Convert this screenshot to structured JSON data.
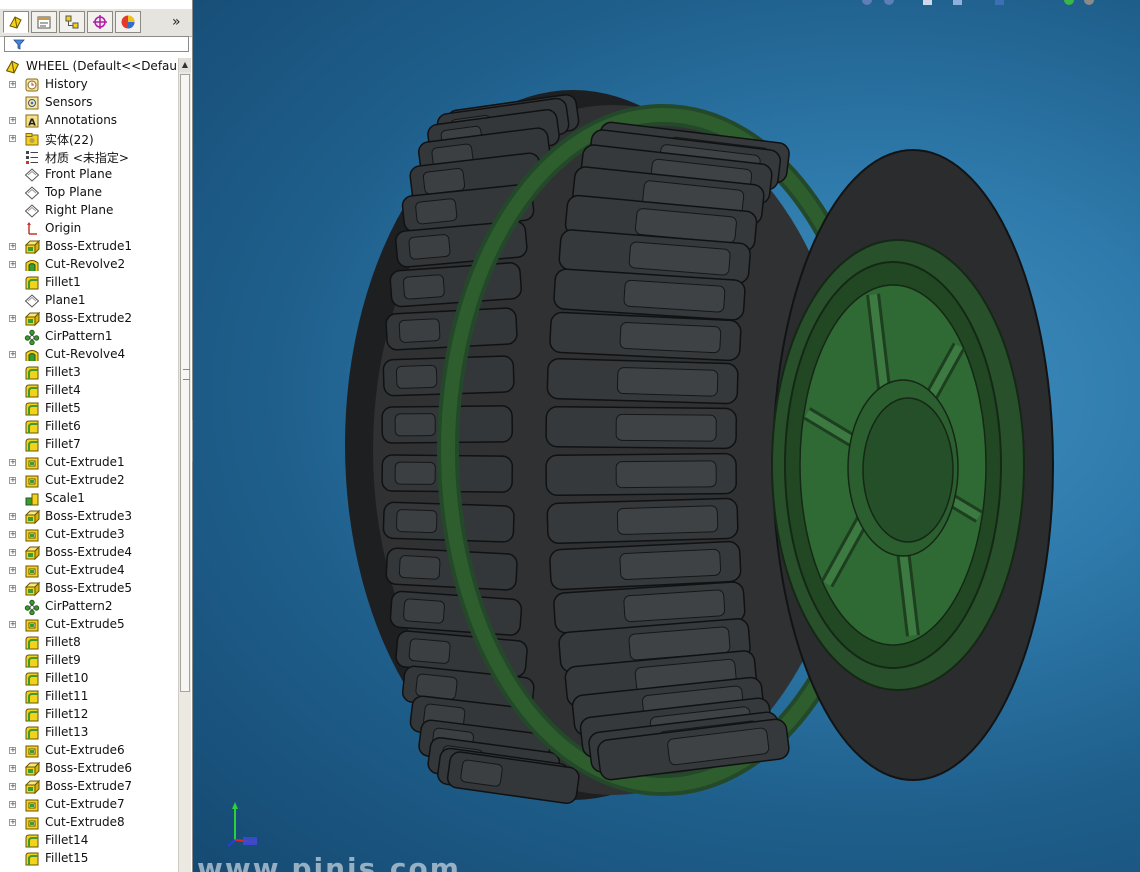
{
  "panel": {
    "more_glyph": "»",
    "tabs": [
      {
        "name": "tab-feature-manager",
        "icon": "part-icon"
      },
      {
        "name": "tab-property-manager",
        "icon": "property-icon"
      },
      {
        "name": "tab-configuration-manager",
        "icon": "config-icon"
      },
      {
        "name": "tab-dimxpert",
        "icon": "target-icon"
      },
      {
        "name": "tab-display-manager",
        "icon": "appearance-icon"
      }
    ],
    "root_label": "WHEEL  (Default<<Default>",
    "tree": [
      {
        "label": "History",
        "icon": "history",
        "exp": true
      },
      {
        "label": "Sensors",
        "icon": "sensor",
        "exp": false
      },
      {
        "label": "Annotations",
        "icon": "annotation",
        "exp": true
      },
      {
        "label": "实体(22)",
        "icon": "folder",
        "exp": true
      },
      {
        "label": "材质 <未指定>",
        "icon": "material",
        "exp": false
      },
      {
        "label": "Front Plane",
        "icon": "plane",
        "exp": false
      },
      {
        "label": "Top Plane",
        "icon": "plane",
        "exp": false
      },
      {
        "label": "Right Plane",
        "icon": "plane",
        "exp": false
      },
      {
        "label": "Origin",
        "icon": "origin",
        "exp": false
      },
      {
        "label": "Boss-Extrude1",
        "icon": "boss",
        "exp": true
      },
      {
        "label": "Cut-Revolve2",
        "icon": "revolve",
        "exp": true
      },
      {
        "label": "Fillet1",
        "icon": "fillet",
        "exp": false
      },
      {
        "label": "Plane1",
        "icon": "plane",
        "exp": false
      },
      {
        "label": "Boss-Extrude2",
        "icon": "boss",
        "exp": true
      },
      {
        "label": "CirPattern1",
        "icon": "pattern",
        "exp": false
      },
      {
        "label": "Cut-Revolve4",
        "icon": "revolve",
        "exp": true
      },
      {
        "label": "Fillet3",
        "icon": "fillet",
        "exp": false
      },
      {
        "label": "Fillet4",
        "icon": "fillet",
        "exp": false
      },
      {
        "label": "Fillet5",
        "icon": "fillet",
        "exp": false
      },
      {
        "label": "Fillet6",
        "icon": "fillet",
        "exp": false
      },
      {
        "label": "Fillet7",
        "icon": "fillet",
        "exp": false
      },
      {
        "label": "Cut-Extrude1",
        "icon": "cut",
        "exp": true
      },
      {
        "label": "Cut-Extrude2",
        "icon": "cut",
        "exp": true
      },
      {
        "label": "Scale1",
        "icon": "scale",
        "exp": false
      },
      {
        "label": "Boss-Extrude3",
        "icon": "boss",
        "exp": true
      },
      {
        "label": "Cut-Extrude3",
        "icon": "cut",
        "exp": true
      },
      {
        "label": "Boss-Extrude4",
        "icon": "boss",
        "exp": true
      },
      {
        "label": "Cut-Extrude4",
        "icon": "cut",
        "exp": true
      },
      {
        "label": "Boss-Extrude5",
        "icon": "boss",
        "exp": true
      },
      {
        "label": "CirPattern2",
        "icon": "pattern",
        "exp": false
      },
      {
        "label": "Cut-Extrude5",
        "icon": "cut",
        "exp": true
      },
      {
        "label": "Fillet8",
        "icon": "fillet",
        "exp": false
      },
      {
        "label": "Fillet9",
        "icon": "fillet",
        "exp": false
      },
      {
        "label": "Fillet10",
        "icon": "fillet",
        "exp": false
      },
      {
        "label": "Fillet11",
        "icon": "fillet",
        "exp": false
      },
      {
        "label": "Fillet12",
        "icon": "fillet",
        "exp": false
      },
      {
        "label": "Fillet13",
        "icon": "fillet",
        "exp": false
      },
      {
        "label": "Cut-Extrude6",
        "icon": "cut",
        "exp": true
      },
      {
        "label": "Boss-Extrude6",
        "icon": "boss",
        "exp": true
      },
      {
        "label": "Boss-Extrude7",
        "icon": "boss",
        "exp": true
      },
      {
        "label": "Cut-Extrude7",
        "icon": "cut",
        "exp": true
      },
      {
        "label": "Cut-Extrude8",
        "icon": "cut",
        "exp": true
      },
      {
        "label": "Fillet14",
        "icon": "fillet",
        "exp": false
      },
      {
        "label": "Fillet15",
        "icon": "fillet",
        "exp": false
      }
    ]
  },
  "viewport": {
    "watermark": "www.pinjs.com",
    "tire_color": "#2f3133",
    "rim_color": "#2e5d2e",
    "background_color": "#2a6f9e"
  },
  "colors": {
    "feature_icon_yellow": "#f2d21b",
    "feature_icon_green": "#3c9a2e",
    "tree_text": "#111111"
  }
}
